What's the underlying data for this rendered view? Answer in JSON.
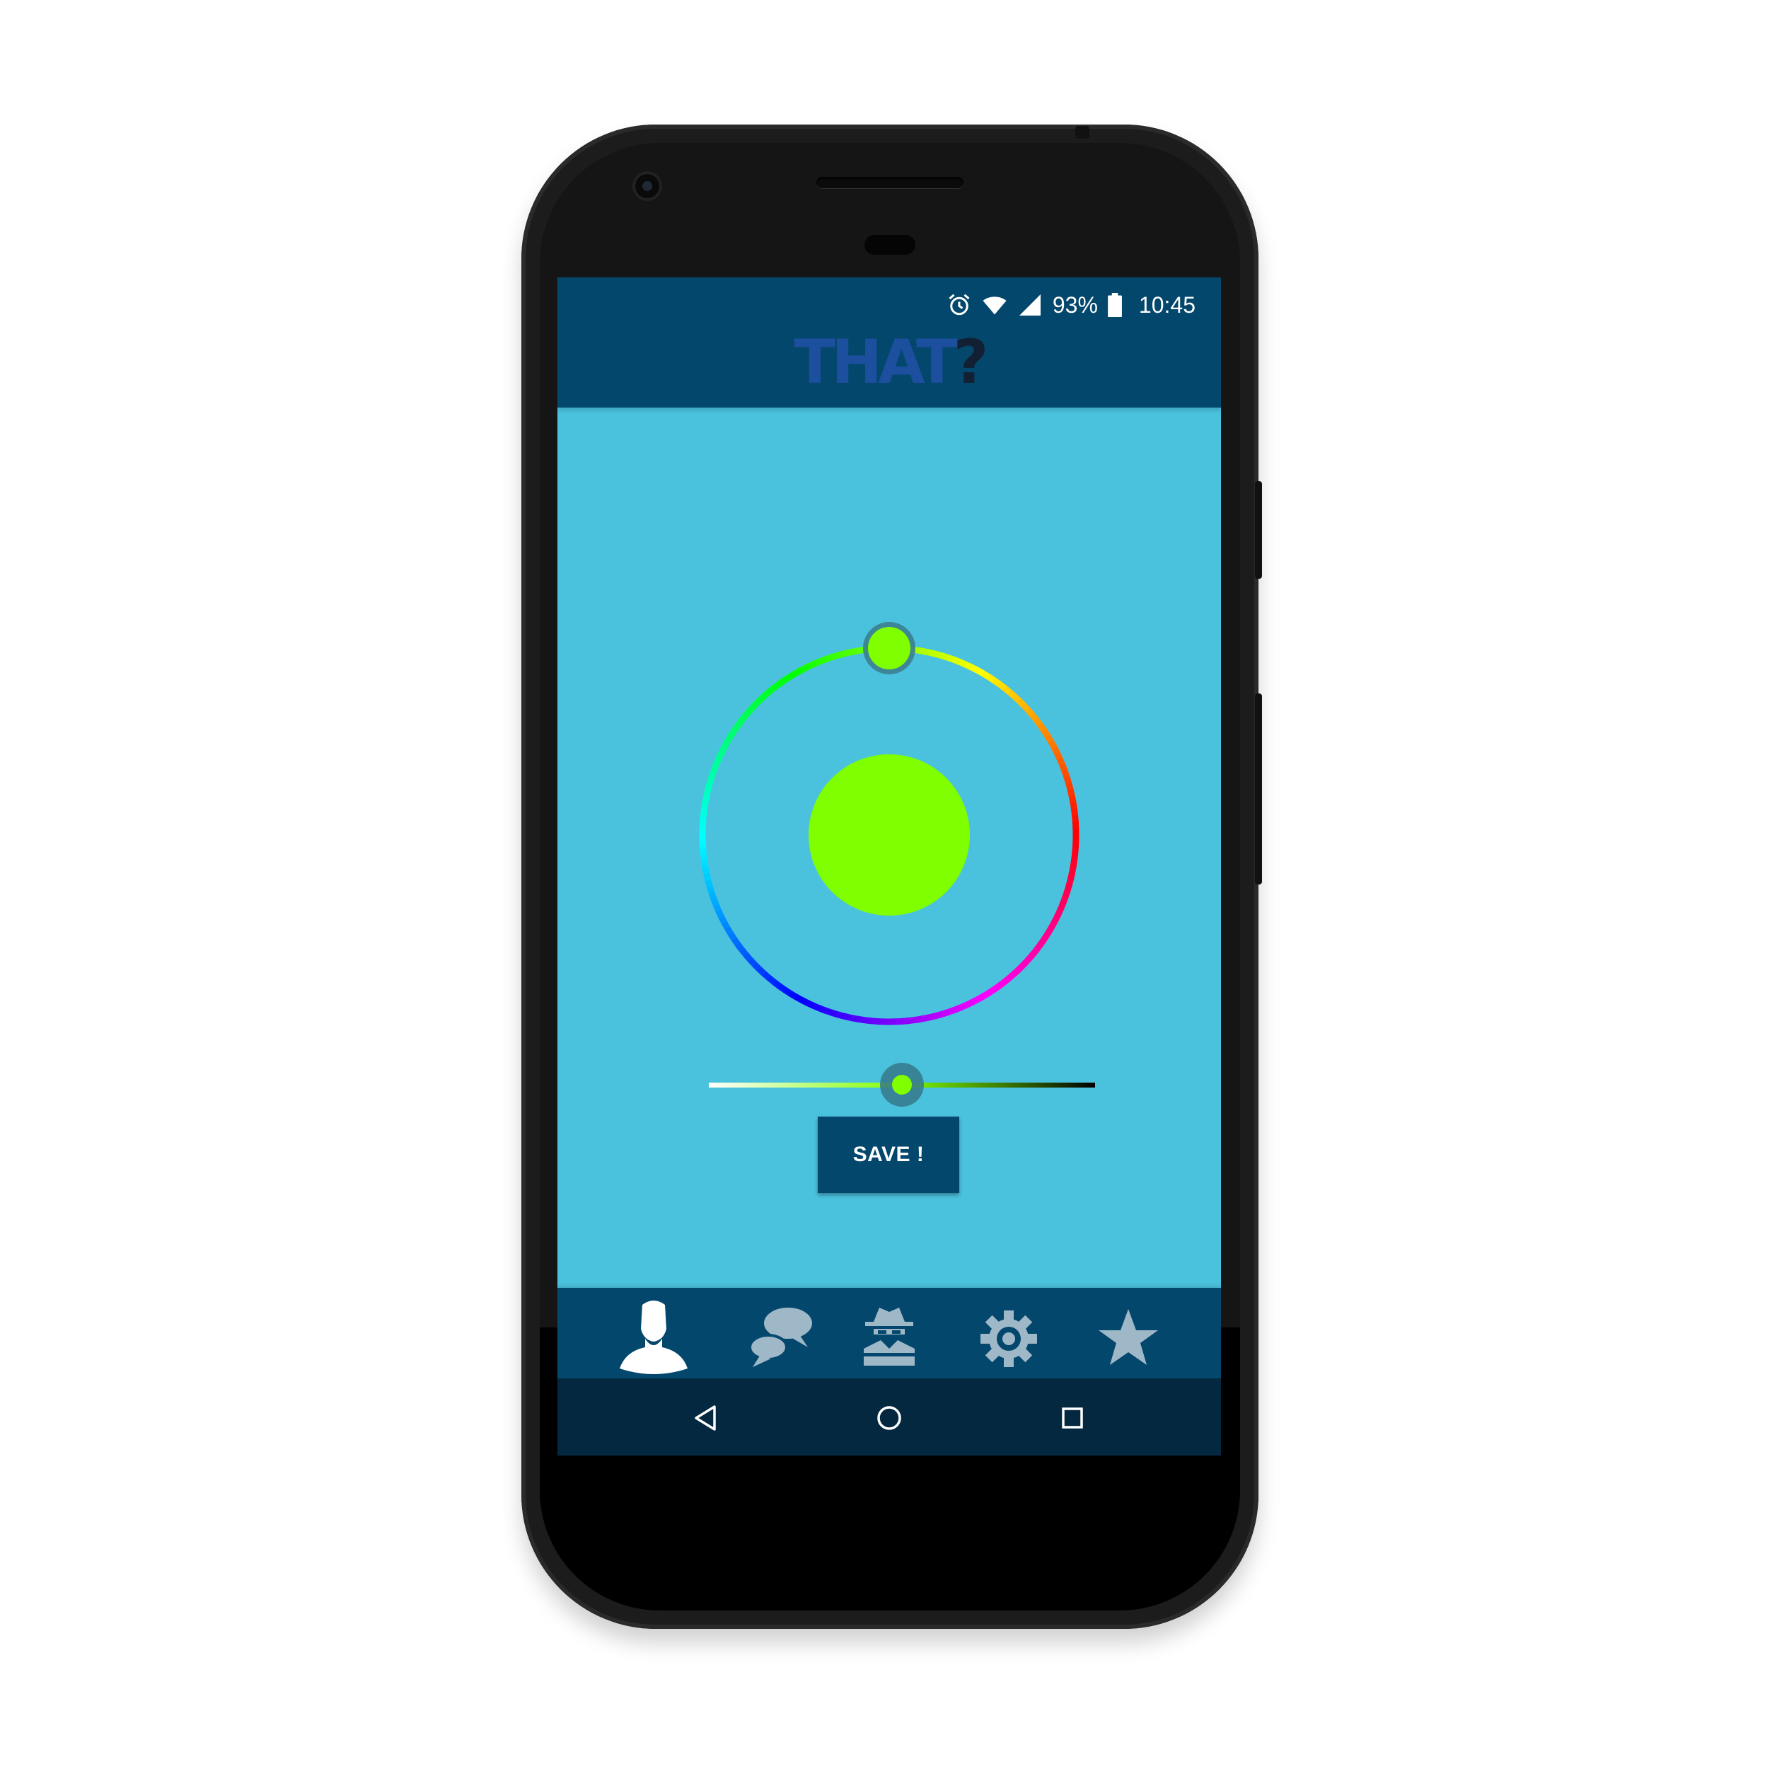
{
  "status_bar": {
    "battery": "93%",
    "time": "10:45",
    "icons": [
      "alarm-icon",
      "wifi-icon",
      "signal-icon",
      "battery-icon"
    ]
  },
  "app_bar": {
    "logo_main": "THAT",
    "logo_suffix": "?"
  },
  "color_picker": {
    "selected_color": "#7fff00",
    "hue_degrees": 90,
    "shade_fraction": 0.5
  },
  "save_button": {
    "label": "SAVE !"
  },
  "bottom_nav": {
    "items": [
      {
        "icon": "profile-icon",
        "active": true
      },
      {
        "icon": "chat-icon",
        "active": false
      },
      {
        "icon": "spy-icon",
        "active": false
      },
      {
        "icon": "gear-icon",
        "active": false
      },
      {
        "icon": "star-icon",
        "active": false
      }
    ]
  },
  "system_nav": {
    "items": [
      "back-icon",
      "home-icon",
      "recents-icon"
    ]
  },
  "colors": {
    "primary_dark": "#04476c",
    "background": "#4ac2de",
    "nav_inactive": "#9fb8c8",
    "nav_active": "#ffffff"
  }
}
